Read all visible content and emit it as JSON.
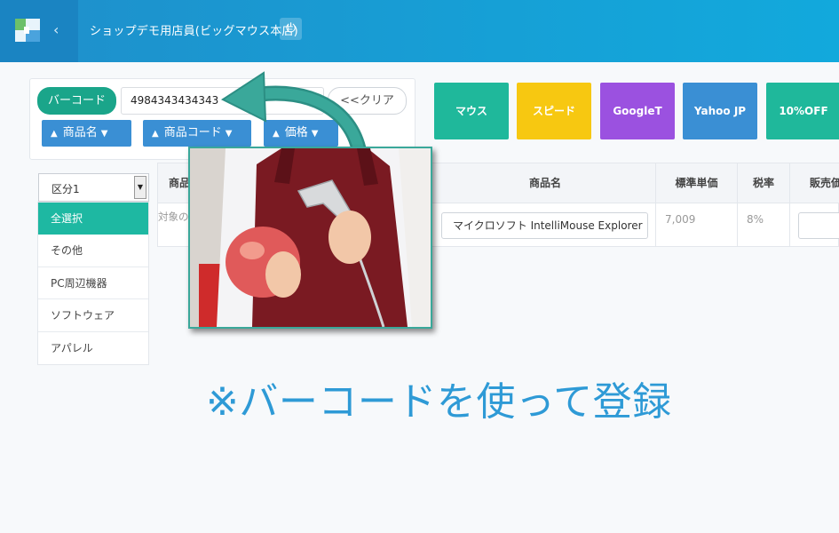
{
  "header": {
    "shop_name": "ショップデモ用店員(ビッグマウス本店)"
  },
  "scan": {
    "barcode_label": "バーコード",
    "barcode_value": "4984343434343",
    "clear_label": "<<クリア",
    "sort_buttons": [
      {
        "label": "商品名"
      },
      {
        "label": "商品コード"
      },
      {
        "label": "価格"
      }
    ]
  },
  "quick_buttons": [
    {
      "label": "マウス",
      "color": "#1fb89b"
    },
    {
      "label": "スピード",
      "color": "#f7c811"
    },
    {
      "label": "GoogleT",
      "color": "#9b51e0"
    },
    {
      "label": "Yahoo JP",
      "color": "#3a8fd4"
    },
    {
      "label": "10%OFF",
      "color": "#1fb89b"
    }
  ],
  "categories": {
    "select_value": "区分1",
    "items": [
      {
        "label": "全選択",
        "active": true
      },
      {
        "label": "その他",
        "active": false
      },
      {
        "label": "PC周辺機器",
        "active": false
      },
      {
        "label": "ソフトウェア",
        "active": false
      },
      {
        "label": "アパレル",
        "active": false
      }
    ]
  },
  "table": {
    "headers": {
      "left_name": "商品名",
      "name": "商品名",
      "unit_price": "標準単価",
      "tax": "税率",
      "sale_price": "販売価"
    },
    "empty_note": "対象の",
    "rows": [
      {
        "name": "マイクロソフト IntelliMouse Explorer",
        "unit_price": "7,009",
        "tax": "8%"
      }
    ]
  },
  "caption": "※バーコードを使って登録",
  "colors": {
    "header": "#1a94d0",
    "accent": "#1aa58a",
    "caption": "#2e9ad6"
  }
}
